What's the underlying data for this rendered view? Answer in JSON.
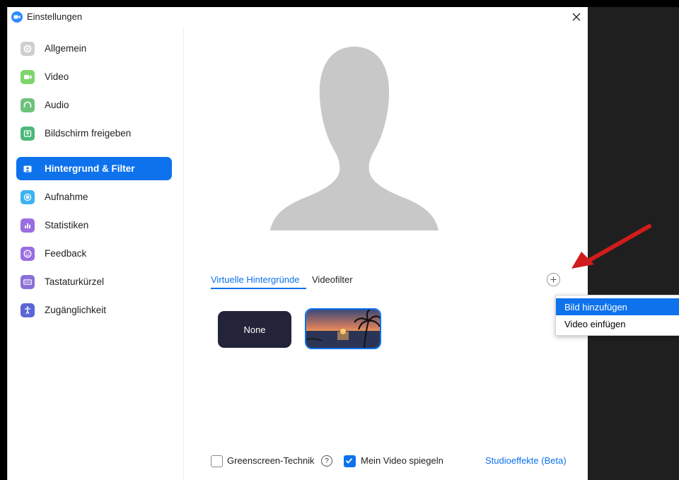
{
  "window": {
    "title": "Einstellungen",
    "close_symbol": "✕"
  },
  "sidebar": {
    "items": [
      {
        "label": "Allgemein",
        "icon": "gear-icon",
        "color": "#c9c9c9"
      },
      {
        "label": "Video",
        "icon": "video-camera-icon",
        "color": "#7dd66b"
      },
      {
        "label": "Audio",
        "icon": "headphones-icon",
        "color": "#6ec27c"
      },
      {
        "label": "Bildschirm freigeben",
        "icon": "share-screen-icon",
        "color": "#4cb87a"
      },
      {
        "label": "Hintergrund & Filter",
        "icon": "portrait-icon",
        "color": "#0e72ed",
        "active": true
      },
      {
        "label": "Aufnahme",
        "icon": "record-icon",
        "color": "#3db2f2"
      },
      {
        "label": "Statistiken",
        "icon": "bar-chart-icon",
        "color": "#9a6de0"
      },
      {
        "label": "Feedback",
        "icon": "smiley-icon",
        "color": "#9a6de0"
      },
      {
        "label": "Tastaturkürzel",
        "icon": "keyboard-icon",
        "color": "#8b6fd8"
      },
      {
        "label": "Zugänglichkeit",
        "icon": "accessibility-icon",
        "color": "#5a66d6"
      }
    ]
  },
  "tabs": {
    "virtual": "Virtuelle Hintergründe",
    "filters": "Videofilter"
  },
  "add_button": {
    "symbol": "+"
  },
  "backgrounds": {
    "none_label": "None"
  },
  "footer": {
    "greenscreen_label": "Greenscreen-Technik",
    "greenscreen_checked": false,
    "help_symbol": "?",
    "mirror_label": "Mein Video spiegeln",
    "mirror_checked": true,
    "studio_link": "Studioeffekte (Beta)"
  },
  "dropdown": {
    "items": [
      "Bild hinzufügen",
      "Video einfügen"
    ]
  },
  "colors": {
    "accent": "#0e72ed",
    "arrow": "#d01c1c"
  }
}
